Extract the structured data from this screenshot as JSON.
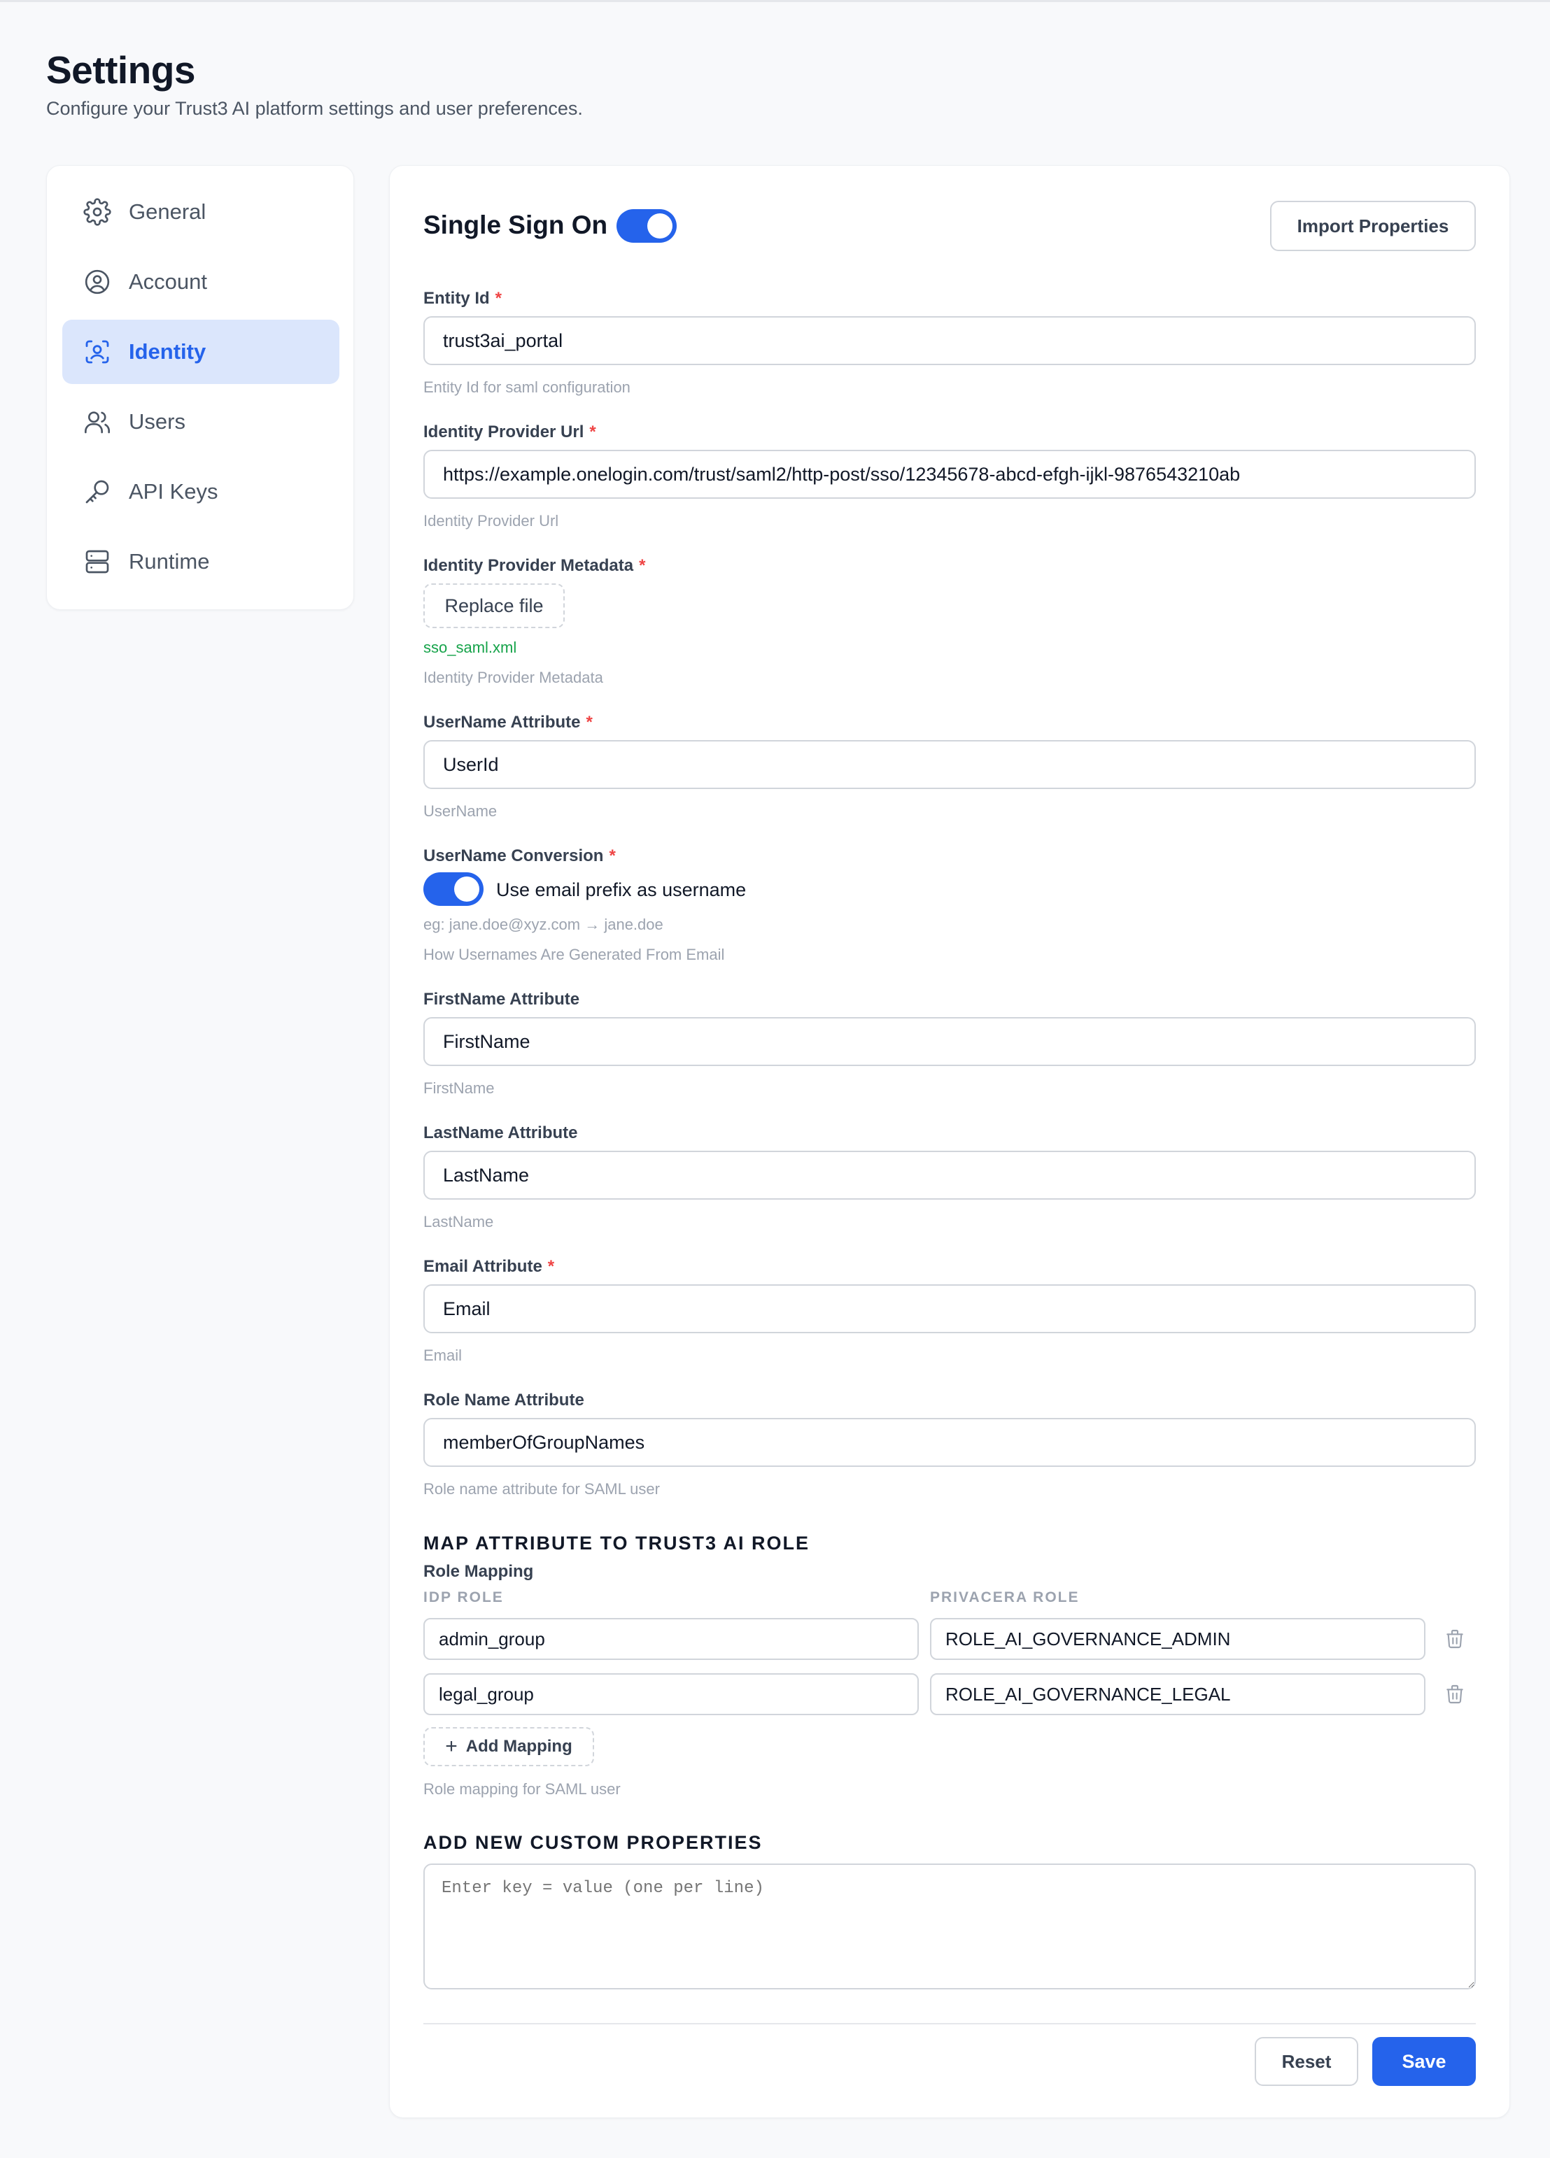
{
  "page": {
    "title": "Settings",
    "subtitle": "Configure your Trust3 AI platform settings and user preferences."
  },
  "sidebar": {
    "items": [
      {
        "label": "General",
        "icon": "gear-icon"
      },
      {
        "label": "Account",
        "icon": "user-circle-icon"
      },
      {
        "label": "Identity",
        "icon": "identity-scan-icon",
        "active": true
      },
      {
        "label": "Users",
        "icon": "users-icon"
      },
      {
        "label": "API Keys",
        "icon": "key-icon"
      },
      {
        "label": "Runtime",
        "icon": "server-icon"
      }
    ]
  },
  "sso": {
    "title": "Single Sign On",
    "enabled": true,
    "import_label": "Import Properties"
  },
  "fields": {
    "entity_id": {
      "label": "Entity Id",
      "value": "trust3ai_portal",
      "help": "Entity Id for saml configuration"
    },
    "idp_url": {
      "label": "Identity Provider Url",
      "value": "https://example.onelogin.com/trust/saml2/http-post/sso/12345678-abcd-efgh-ijkl-9876543210ab",
      "help": "Identity Provider Url"
    },
    "idp_metadata": {
      "label": "Identity Provider Metadata",
      "button": "Replace file",
      "file": "sso_saml.xml",
      "help": "Identity Provider Metadata"
    },
    "username_attr": {
      "label": "UserName Attribute",
      "value": "UserId",
      "help": "UserName"
    },
    "username_conversion": {
      "label": "UserName Conversion",
      "toggle_label": "Use email prefix as username",
      "enabled": true,
      "example": "eg: jane.doe@xyz.com → jane.doe",
      "help": "How Usernames Are Generated From Email"
    },
    "firstname_attr": {
      "label": "FirstName Attribute",
      "value": "FirstName",
      "help": "FirstName"
    },
    "lastname_attr": {
      "label": "LastName Attribute",
      "value": "LastName",
      "help": "LastName"
    },
    "email_attr": {
      "label": "Email Attribute",
      "value": "Email",
      "help": "Email"
    },
    "role_attr": {
      "label": "Role Name Attribute",
      "value": "memberOfGroupNames",
      "help": "Role name attribute for SAML user"
    }
  },
  "required_mark": "*",
  "mapping": {
    "section_title": "MAP ATTRIBUTE TO TRUST3 AI ROLE",
    "sub_label": "Role Mapping",
    "col_idp": "IDP ROLE",
    "col_privacera": "PRIVACERA ROLE",
    "rows": [
      {
        "idp": "admin_group",
        "role": "ROLE_AI_GOVERNANCE_ADMIN"
      },
      {
        "idp": "legal_group",
        "role": "ROLE_AI_GOVERNANCE_LEGAL"
      }
    ],
    "add_label": "Add Mapping",
    "help": "Role mapping for SAML user"
  },
  "custom": {
    "section_title": "ADD NEW CUSTOM PROPERTIES",
    "placeholder": "Enter key = value (one per line)"
  },
  "actions": {
    "reset": "Reset",
    "save": "Save"
  },
  "colors": {
    "accent": "#2563eb",
    "active_bg": "#dbe6fc",
    "required": "#ef4444",
    "file_ok": "#16a34a"
  }
}
